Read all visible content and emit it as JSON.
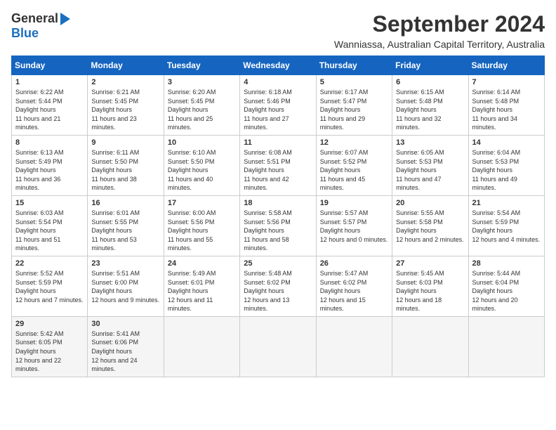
{
  "header": {
    "logo_general": "General",
    "logo_blue": "Blue",
    "month_title": "September 2024",
    "location": "Wanniassa, Australian Capital Territory, Australia"
  },
  "days_of_week": [
    "Sunday",
    "Monday",
    "Tuesday",
    "Wednesday",
    "Thursday",
    "Friday",
    "Saturday"
  ],
  "weeks": [
    [
      {
        "day": "1",
        "sunrise": "6:22 AM",
        "sunset": "5:44 PM",
        "daylight": "11 hours and 21 minutes."
      },
      {
        "day": "2",
        "sunrise": "6:21 AM",
        "sunset": "5:45 PM",
        "daylight": "11 hours and 23 minutes."
      },
      {
        "day": "3",
        "sunrise": "6:20 AM",
        "sunset": "5:45 PM",
        "daylight": "11 hours and 25 minutes."
      },
      {
        "day": "4",
        "sunrise": "6:18 AM",
        "sunset": "5:46 PM",
        "daylight": "11 hours and 27 minutes."
      },
      {
        "day": "5",
        "sunrise": "6:17 AM",
        "sunset": "5:47 PM",
        "daylight": "11 hours and 29 minutes."
      },
      {
        "day": "6",
        "sunrise": "6:15 AM",
        "sunset": "5:48 PM",
        "daylight": "11 hours and 32 minutes."
      },
      {
        "day": "7",
        "sunrise": "6:14 AM",
        "sunset": "5:48 PM",
        "daylight": "11 hours and 34 minutes."
      }
    ],
    [
      {
        "day": "8",
        "sunrise": "6:13 AM",
        "sunset": "5:49 PM",
        "daylight": "11 hours and 36 minutes."
      },
      {
        "day": "9",
        "sunrise": "6:11 AM",
        "sunset": "5:50 PM",
        "daylight": "11 hours and 38 minutes."
      },
      {
        "day": "10",
        "sunrise": "6:10 AM",
        "sunset": "5:50 PM",
        "daylight": "11 hours and 40 minutes."
      },
      {
        "day": "11",
        "sunrise": "6:08 AM",
        "sunset": "5:51 PM",
        "daylight": "11 hours and 42 minutes."
      },
      {
        "day": "12",
        "sunrise": "6:07 AM",
        "sunset": "5:52 PM",
        "daylight": "11 hours and 45 minutes."
      },
      {
        "day": "13",
        "sunrise": "6:05 AM",
        "sunset": "5:53 PM",
        "daylight": "11 hours and 47 minutes."
      },
      {
        "day": "14",
        "sunrise": "6:04 AM",
        "sunset": "5:53 PM",
        "daylight": "11 hours and 49 minutes."
      }
    ],
    [
      {
        "day": "15",
        "sunrise": "6:03 AM",
        "sunset": "5:54 PM",
        "daylight": "11 hours and 51 minutes."
      },
      {
        "day": "16",
        "sunrise": "6:01 AM",
        "sunset": "5:55 PM",
        "daylight": "11 hours and 53 minutes."
      },
      {
        "day": "17",
        "sunrise": "6:00 AM",
        "sunset": "5:56 PM",
        "daylight": "11 hours and 55 minutes."
      },
      {
        "day": "18",
        "sunrise": "5:58 AM",
        "sunset": "5:56 PM",
        "daylight": "11 hours and 58 minutes."
      },
      {
        "day": "19",
        "sunrise": "5:57 AM",
        "sunset": "5:57 PM",
        "daylight": "12 hours and 0 minutes."
      },
      {
        "day": "20",
        "sunrise": "5:55 AM",
        "sunset": "5:58 PM",
        "daylight": "12 hours and 2 minutes."
      },
      {
        "day": "21",
        "sunrise": "5:54 AM",
        "sunset": "5:59 PM",
        "daylight": "12 hours and 4 minutes."
      }
    ],
    [
      {
        "day": "22",
        "sunrise": "5:52 AM",
        "sunset": "5:59 PM",
        "daylight": "12 hours and 7 minutes."
      },
      {
        "day": "23",
        "sunrise": "5:51 AM",
        "sunset": "6:00 PM",
        "daylight": "12 hours and 9 minutes."
      },
      {
        "day": "24",
        "sunrise": "5:49 AM",
        "sunset": "6:01 PM",
        "daylight": "12 hours and 11 minutes."
      },
      {
        "day": "25",
        "sunrise": "5:48 AM",
        "sunset": "6:02 PM",
        "daylight": "12 hours and 13 minutes."
      },
      {
        "day": "26",
        "sunrise": "5:47 AM",
        "sunset": "6:02 PM",
        "daylight": "12 hours and 15 minutes."
      },
      {
        "day": "27",
        "sunrise": "5:45 AM",
        "sunset": "6:03 PM",
        "daylight": "12 hours and 18 minutes."
      },
      {
        "day": "28",
        "sunrise": "5:44 AM",
        "sunset": "6:04 PM",
        "daylight": "12 hours and 20 minutes."
      }
    ],
    [
      {
        "day": "29",
        "sunrise": "5:42 AM",
        "sunset": "6:05 PM",
        "daylight": "12 hours and 22 minutes."
      },
      {
        "day": "30",
        "sunrise": "5:41 AM",
        "sunset": "6:06 PM",
        "daylight": "12 hours and 24 minutes."
      },
      null,
      null,
      null,
      null,
      null
    ]
  ]
}
